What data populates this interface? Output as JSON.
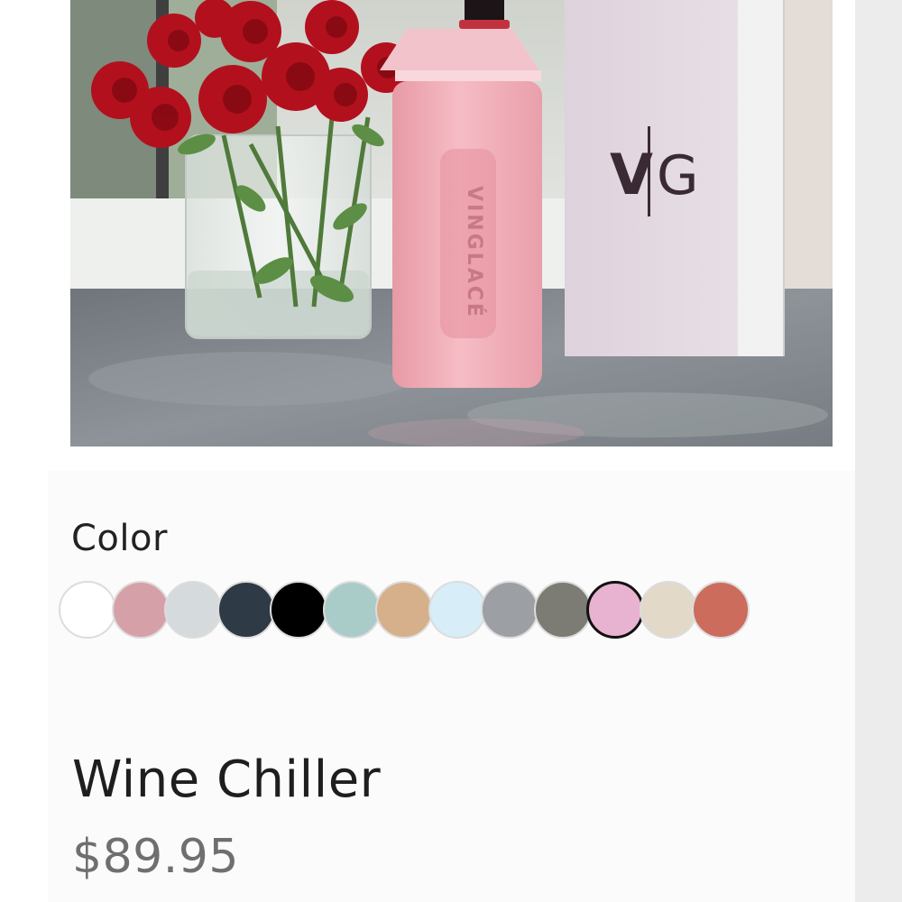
{
  "product": {
    "image_brand_text": "VINGLACÉ",
    "box_logo": {
      "left": "V",
      "right": "G"
    },
    "color_label": "Color",
    "colors": [
      {
        "name": "white",
        "hex": "#ffffff",
        "selected": false
      },
      {
        "name": "blush-pink",
        "hex": "#d6a0a8",
        "selected": false
      },
      {
        "name": "light-gray",
        "hex": "#d5dadd",
        "selected": false
      },
      {
        "name": "charcoal-navy",
        "hex": "#2f3a47",
        "selected": false
      },
      {
        "name": "black",
        "hex": "#000000",
        "selected": false
      },
      {
        "name": "seafoam",
        "hex": "#a9ccc8",
        "selected": false
      },
      {
        "name": "tan",
        "hex": "#d6b08a",
        "selected": false
      },
      {
        "name": "sky-blue",
        "hex": "#d7edf8",
        "selected": false
      },
      {
        "name": "gray",
        "hex": "#9c9fa3",
        "selected": false
      },
      {
        "name": "slate-gray",
        "hex": "#7c7c74",
        "selected": false
      },
      {
        "name": "pink",
        "hex": "#e8b3d0",
        "selected": true
      },
      {
        "name": "cream",
        "hex": "#e2d9c8",
        "selected": false
      },
      {
        "name": "coral",
        "hex": "#cc6c5c",
        "selected": false
      }
    ],
    "title": "Wine Chiller",
    "price": "$89.95"
  }
}
